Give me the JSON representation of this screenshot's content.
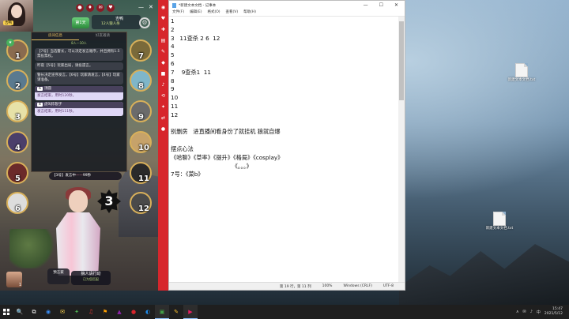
{
  "game": {
    "day_label": "第1天",
    "host_name": "吉鸭",
    "host_sub": "12人狼人杀",
    "streamer_tag": "吉鸭",
    "tabs": [
      "房间信息",
      "好友邀请"
    ],
    "sub_header": "8人—10人",
    "messages": [
      {
        "text": "【7号】当选警长，可以决定发言顺序，并且拥有1.5票投票权。"
      },
      {
        "text": "昨夜【5号】玩家出局，请投遗言。"
      },
      {
        "text": "警长决定逆序发言，【6号】玩家请发言，【4号】玩家请准备。"
      }
    ],
    "bubbles": [
      {
        "no": "6",
        "name": "汤圆",
        "text": "发言结束，用时120秒。"
      },
      {
        "no": "4",
        "name": "虎叫炸裂子",
        "text": "发言结束，用时111秒。"
      }
    ],
    "speech_bar": {
      "prefix": "【3号】发言中",
      "dots": "——",
      "time": "99秒"
    },
    "big_number": "3",
    "seats": [
      {
        "num": "1"
      },
      {
        "num": "2"
      },
      {
        "num": "3"
      },
      {
        "num": "4"
      },
      {
        "num": "5"
      },
      {
        "num": "6"
      },
      {
        "num": "7"
      },
      {
        "num": "8"
      },
      {
        "num": "9"
      },
      {
        "num": "10"
      },
      {
        "num": "11"
      },
      {
        "num": "12"
      }
    ],
    "role_label": "预言家",
    "action": {
      "title": "狼人请行动",
      "sub": "已为您匹配"
    },
    "bottom_avatar_num": "1",
    "sidebar_icons": [
      "◉",
      "♥",
      "✚",
      "▤",
      "✎",
      "◆",
      "■",
      "♪",
      "⟲",
      "✦",
      "⇄",
      "●"
    ]
  },
  "notepad": {
    "title": "*新建文本文档 - 记事本",
    "menu": [
      "文件(F)",
      "编辑(E)",
      "格式(O)",
      "查看(V)",
      "帮助(H)"
    ],
    "lines": [
      "1",
      "2",
      "3   11查杀 2 6  12",
      "4",
      "5",
      "6",
      "7    9查杀1  11",
      "8",
      "9",
      "10",
      "11",
      "12",
      "",
      "别删房   进直播间看身份了就挂机 狼就自爆",
      "",
      "摆点心法",
      "《哈聊》《草率》《提升》《格局》《cosplay》",
      "                                  《。。。》",
      "7号：《菜b》"
    ],
    "status": {
      "position": "第 19 行，第 11 列",
      "zoom": "100%",
      "eol": "Windows (CRLF)",
      "encoding": "UTF-8"
    }
  },
  "desktop": {
    "icons": [
      {
        "label": "新建文本文档.txt"
      },
      {
        "label": "新建文本文档.txt"
      }
    ]
  },
  "taskbar": {
    "apps": [
      "🔍",
      "⧉",
      "◉",
      "✉",
      "✦",
      "♫",
      "⚑",
      "▲",
      "●",
      "◐",
      "▣",
      "✎",
      "▶"
    ],
    "app_colors": [
      "#ffffff",
      "#ffffff",
      "#3a8df5",
      "#ffd54f",
      "#4caf50",
      "#e53935",
      "#ffa000",
      "#8e24aa",
      "#d7262c",
      "#1e88e5",
      "#43a047",
      "#fbc02d",
      "#e91e63"
    ],
    "tray": [
      "∧",
      "✉",
      "♪",
      "中"
    ],
    "time": "15:47",
    "date": "2021/5/12"
  }
}
